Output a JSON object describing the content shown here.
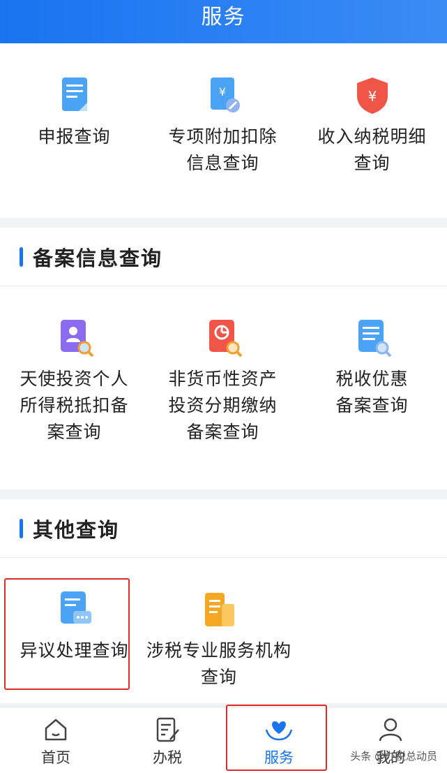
{
  "header": {
    "title": "服务"
  },
  "top_items": [
    {
      "label1": "申报查询",
      "label2": ""
    },
    {
      "label1": "专项附加扣除",
      "label2": "信息查询"
    },
    {
      "label1": "收入纳税明细",
      "label2": "查询"
    }
  ],
  "section_filing": {
    "title": "备案信息查询",
    "items": [
      {
        "label1": "天使投资个人",
        "label2": "所得税抵扣备",
        "label3": "案查询"
      },
      {
        "label1": "非货币性资产",
        "label2": "投资分期缴纳",
        "label3": "备案查询"
      },
      {
        "label1": "税收优惠",
        "label2": "备案查询",
        "label3": ""
      }
    ]
  },
  "section_other": {
    "title": "其他查询",
    "items": [
      {
        "label1": "异议处理查询",
        "label2": ""
      },
      {
        "label1": "涉税专业服务机构",
        "label2": "查询"
      }
    ]
  },
  "tabs": [
    {
      "label": "首页",
      "icon": "home-icon"
    },
    {
      "label": "办税",
      "icon": "edit-document-icon"
    },
    {
      "label": "服务",
      "icon": "heart-hands-icon",
      "active": true
    },
    {
      "label": "我的",
      "icon": "user-icon"
    }
  ],
  "watermark": "头条 @办税总动员",
  "colors": {
    "brand": "#1a73f0",
    "highlight": "#e02a2a"
  }
}
